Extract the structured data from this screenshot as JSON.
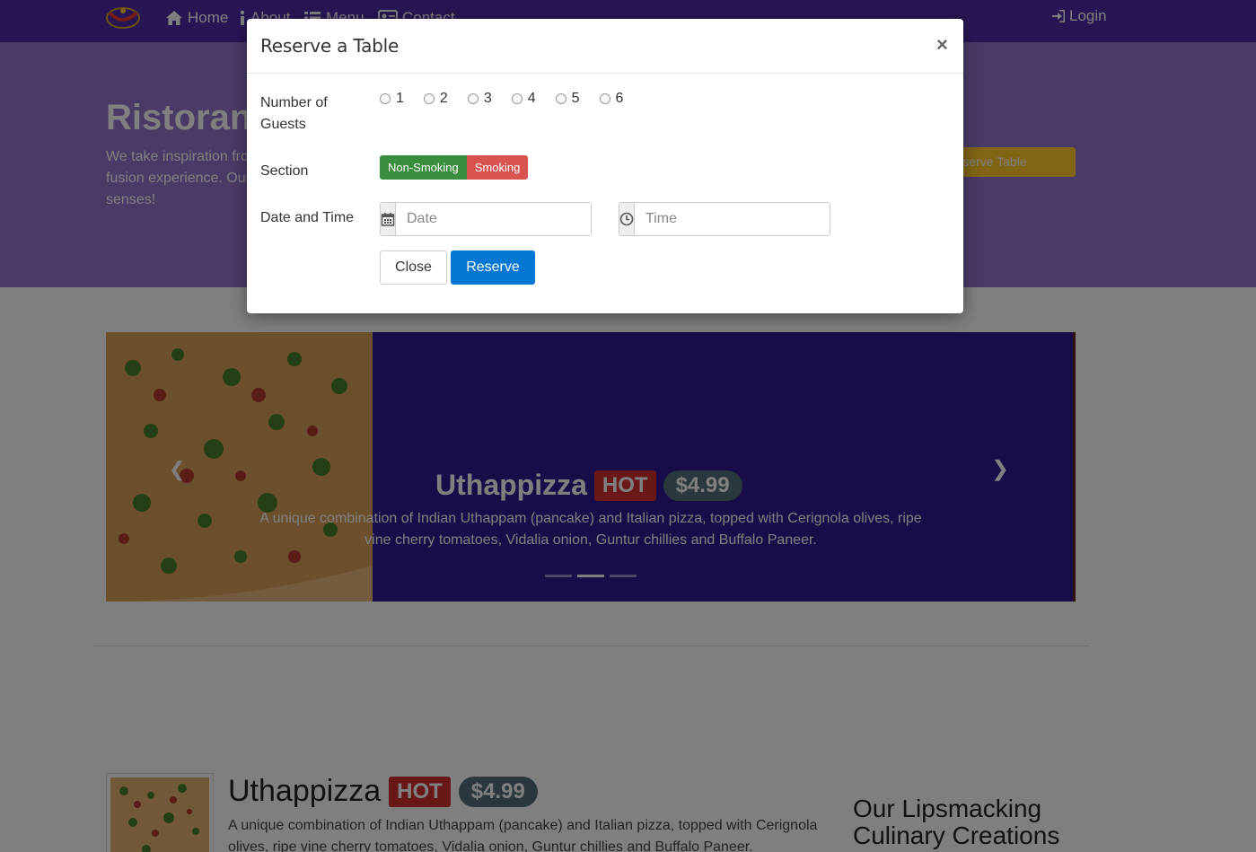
{
  "navbar": {
    "items": [
      {
        "label": "Home",
        "icon": "home-icon"
      },
      {
        "label": "About",
        "icon": "info-icon"
      },
      {
        "label": "Menu",
        "icon": "list-icon"
      },
      {
        "label": "Contact",
        "icon": "address-card-icon"
      }
    ],
    "login": "Login",
    "bg_color": "#512da8"
  },
  "jumbotron": {
    "title": "Ristorante con Fusion",
    "text": "We take inspiration from the World's best cuisines, and create a unique fusion experience. Our lipsmacking creations will tickle your culinary senses!",
    "button": "Reserve Table",
    "bg_color": "#9575cd"
  },
  "carousel": {
    "title": "Uthappizza",
    "badge": "HOT",
    "price": "$4.99",
    "description": "A unique combination of Indian Uthappam (pancake) and Italian pizza, topped with Cerignola olives, ripe vine cherry tomatoes, Vidalia onion, Guntur chillies and Buffalo Paneer.",
    "indicators": 3,
    "active_index": 1,
    "bg_color": "#311b92"
  },
  "featured": {
    "title": "Uthappizza",
    "badge": "HOT",
    "price": "$4.99",
    "description": "A unique combination of Indian Uthappam (pancake) and Italian pizza, topped with Cerignola olives, ripe vine cherry tomatoes, Vidalia onion, Guntur chillies and Buffalo Paneer.",
    "side_heading": "Our Lipsmacking Culinary Creations"
  },
  "modal": {
    "title": "Reserve a Table",
    "close_symbol": "×",
    "guests_label": "Number of Guests",
    "guest_options": [
      "1",
      "2",
      "3",
      "4",
      "5",
      "6"
    ],
    "section_label": "Section",
    "section_options": [
      "Non-Smoking",
      "Smoking"
    ],
    "datetime_label": "Date and Time",
    "date_placeholder": "Date",
    "time_placeholder": "Time",
    "close_button": "Close",
    "reserve_button": "Reserve",
    "colors": {
      "non_smoking": "#388e3c",
      "smoking": "#d9534f",
      "reserve": "#0277d3"
    }
  }
}
